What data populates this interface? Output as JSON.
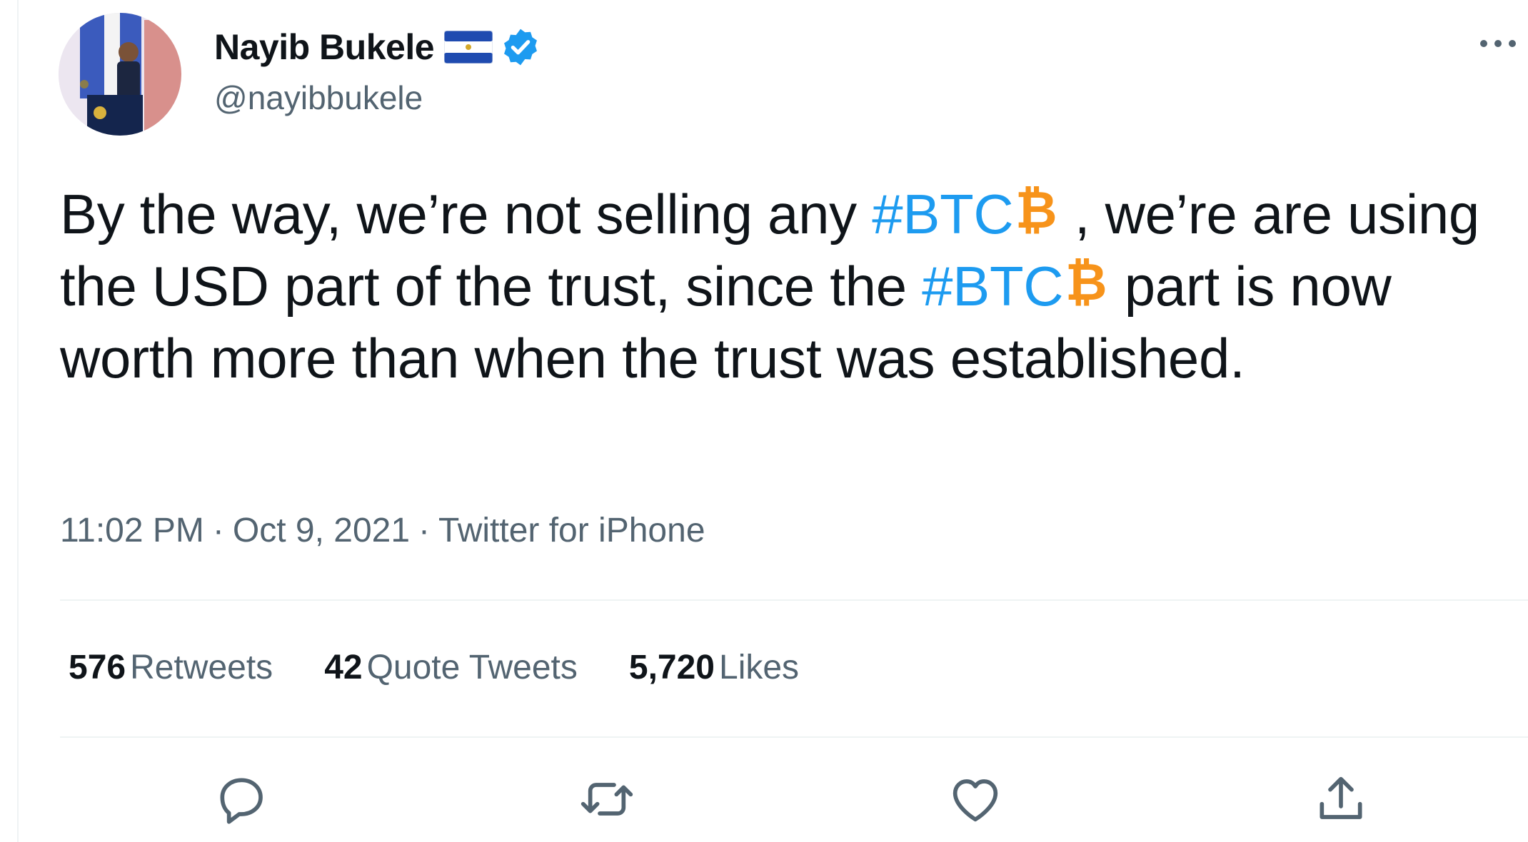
{
  "tweet": {
    "author": {
      "name": "Nayib Bukele",
      "handle": "@nayibbukele",
      "flag_icon": "el-salvador-flag-icon",
      "verified_icon": "verified-badge-icon"
    },
    "text_parts": {
      "p1": "By the way, we’re not selling any ",
      "tag1": "#BTC",
      "p2": " , we’re are using the USD part of the trust, since the ",
      "tag2": "#BTC",
      "p3": "  part is now worth more than when the trust was established."
    },
    "time": "11:02 PM",
    "date": "Oct 9, 2021",
    "source": "Twitter for iPhone",
    "separator": "·"
  },
  "stats": {
    "retweets_count": "576",
    "retweets_label": "Retweets",
    "quotes_count": "42",
    "quotes_label": "Quote Tweets",
    "likes_count": "5,720",
    "likes_label": "Likes"
  },
  "actions": [
    "reply-icon",
    "retweet-icon",
    "like-icon",
    "share-icon"
  ],
  "colors": {
    "hashtag": "#1d9bf0",
    "bitcoin": "#f7931a",
    "verified": "#1d9bf0",
    "secondary_text": "#536471"
  }
}
